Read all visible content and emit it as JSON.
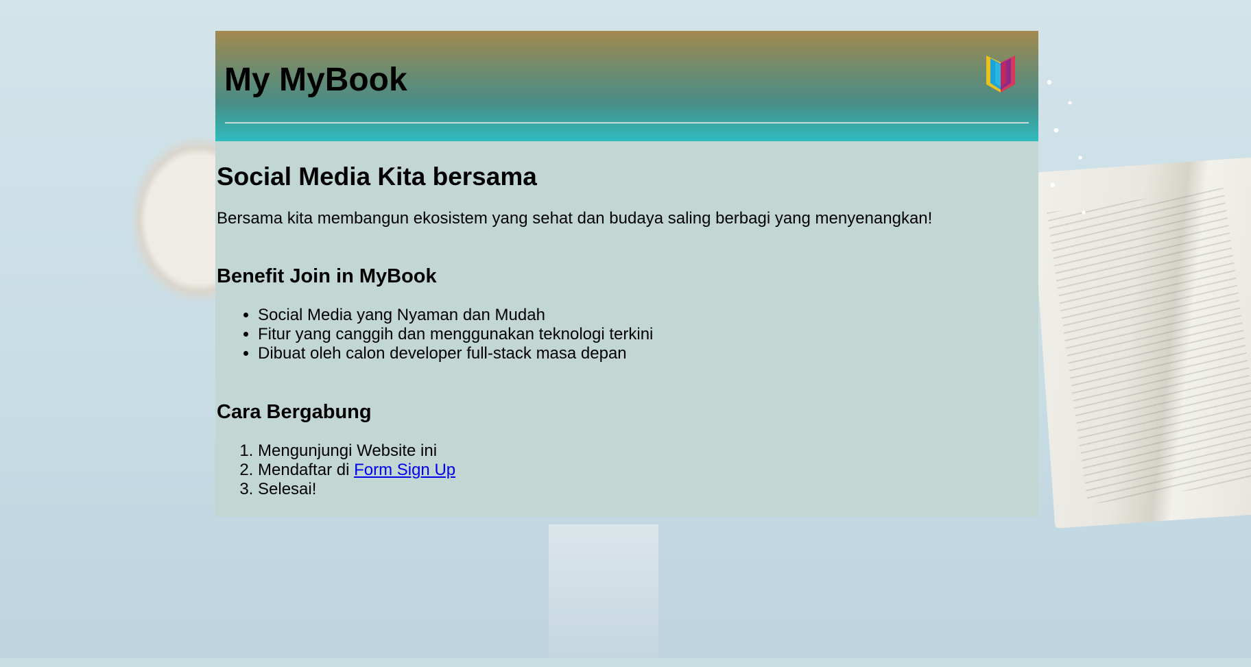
{
  "header": {
    "title": "My MyBook",
    "logo_icon": "open-book-icon"
  },
  "intro": {
    "heading": "Social Media Kita bersama",
    "text": "Bersama kita membangun ekosistem yang sehat dan budaya saling berbagi yang menyenangkan!"
  },
  "benefits": {
    "heading": "Benefit Join in MyBook",
    "items": [
      "Social Media yang Nyaman dan Mudah",
      "Fitur yang canggih dan menggunakan teknologi terkini",
      "Dibuat oleh calon developer full-stack masa depan"
    ]
  },
  "join": {
    "heading": "Cara Bergabung",
    "step1": "Mengunjungi Website ini",
    "step2_prefix": "Mendaftar di ",
    "step2_link": "Form Sign Up",
    "step3": "Selesai!"
  },
  "colors": {
    "header_top": "#a4894f",
    "header_bottom": "#2ebcbd",
    "content_bg": "#c2d6d3",
    "link": "#0000ee"
  }
}
